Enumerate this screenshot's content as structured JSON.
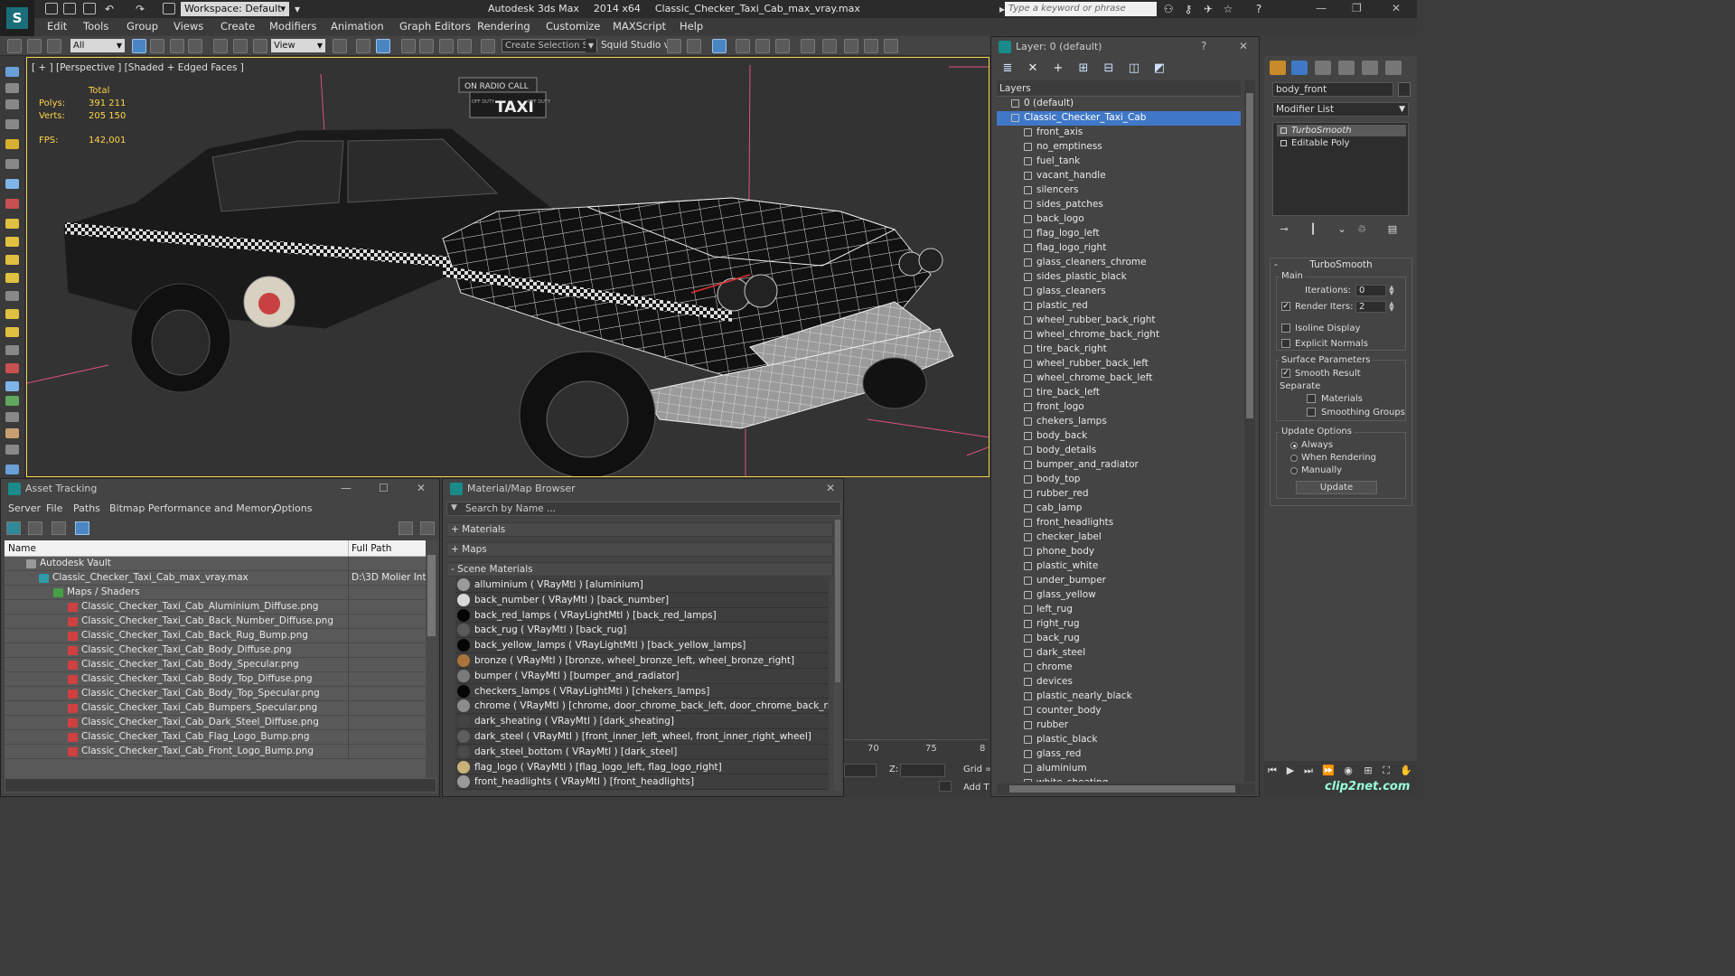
{
  "app": {
    "name": "Autodesk 3ds Max",
    "version": "2014 x64",
    "file": "Classic_Checker_Taxi_Cab_max_vray.max",
    "workspace": "Workspace: Default",
    "search_placeholder": "Type a keyword or phrase"
  },
  "menu": [
    "Edit",
    "Tools",
    "Group",
    "Views",
    "Create",
    "Modifiers",
    "Animation",
    "Graph Editors",
    "Rendering",
    "Customize",
    "MAXScript",
    "Help"
  ],
  "toolbar": {
    "filter": "All",
    "ref_coord": "View",
    "selection_set": "Create Selection Se",
    "plugin": "Squid Studio v"
  },
  "viewport": {
    "label": "[ + ] [Perspective ] [Shaded + Edged Faces ]",
    "stats_header": "Total",
    "polys_label": "Polys:",
    "polys_value": "391 211",
    "verts_label": "Verts:",
    "verts_value": "205 150",
    "fps_label": "FPS:",
    "fps_value": "142,001",
    "taxi_sign_top": "ON RADIO CALL",
    "taxi_sign_main": "TAXI",
    "taxi_sign_left": "OFF DUTY",
    "taxi_sign_right": "OFF DUTY"
  },
  "asset_tracking": {
    "title": "Asset Tracking",
    "menu": [
      "Server",
      "File",
      "Paths",
      "Bitmap Performance and Memory",
      "Options"
    ],
    "col_name": "Name",
    "col_path": "Full Path",
    "vault": "Autodesk Vault",
    "file": "Classic_Checker_Taxi_Cab_max_vray.max",
    "file_path": "D:\\3D Molier Int",
    "maps_group": "Maps / Shaders",
    "maps": [
      "Classic_Checker_Taxi_Cab_Aluminium_Diffuse.png",
      "Classic_Checker_Taxi_Cab_Back_Number_Diffuse.png",
      "Classic_Checker_Taxi_Cab_Back_Rug_Bump.png",
      "Classic_Checker_Taxi_Cab_Body_Diffuse.png",
      "Classic_Checker_Taxi_Cab_Body_Specular.png",
      "Classic_Checker_Taxi_Cab_Body_Top_Diffuse.png",
      "Classic_Checker_Taxi_Cab_Body_Top_Specular.png",
      "Classic_Checker_Taxi_Cab_Bumpers_Specular.png",
      "Classic_Checker_Taxi_Cab_Dark_Steel_Diffuse.png",
      "Classic_Checker_Taxi_Cab_Flag_Logo_Bump.png",
      "Classic_Checker_Taxi_Cab_Front_Logo_Bump.png"
    ]
  },
  "material_browser": {
    "title": "Material/Map Browser",
    "search_placeholder": "Search by Name ...",
    "sections": [
      "+ Materials",
      "+ Maps",
      "- Scene Materials"
    ],
    "materials": [
      {
        "text": "alluminium  ( VRayMtl )  [aluminium]",
        "color": "#9a9a9a"
      },
      {
        "text": "back_number  ( VRayMtl )  [back_number]",
        "color": "#d8d8d8"
      },
      {
        "text": "back_red_lamps  ( VRayLightMtl )  [back_red_lamps]",
        "color": "#050505"
      },
      {
        "text": "back_rug  ( VRayMtl )  [back_rug]",
        "color": "#5a5a5a"
      },
      {
        "text": "back_yellow_lamps  ( VRayLightMtl )  [back_yellow_lamps]",
        "color": "#050505"
      },
      {
        "text": "bronze  ( VRayMtl )  [bronze, wheel_bronze_left, wheel_bronze_right]",
        "color": "#a8743a"
      },
      {
        "text": "bumper  ( VRayMtl )  [bumper_and_radiator]",
        "color": "#7a7a7a"
      },
      {
        "text": "checkers_lamps  ( VRayLightMtl )  [chekers_lamps]",
        "color": "#050505"
      },
      {
        "text": "chrome  ( VRayMtl )  [chrome, door_chrome_back_left, door_chrome_back_right...",
        "color": "#8c8c8c"
      },
      {
        "text": "dark_sheating  ( VRayMtl )  [dark_sheating]",
        "color": "#444444"
      },
      {
        "text": "dark_steel  ( VRayMtl )  [front_inner_left_wheel, front_inner_right_wheel]",
        "color": "#5e5e5e"
      },
      {
        "text": "dark_steel_bottom  ( VRayMtl )  [dark_steel]",
        "color": "#4a4a4a"
      },
      {
        "text": "flag_logo  ( VRayMtl )  [flag_logo_left, flag_logo_right]",
        "color": "#c9b27a"
      },
      {
        "text": "front_headlights  ( VRayMtl )  [front_headlights]",
        "color": "#9a9a9a"
      }
    ]
  },
  "layer_explorer": {
    "title": "Layer: 0 (default)",
    "help": "?",
    "header": "Layers",
    "default_layer": "0 (default)",
    "selected_layer": "Classic_Checker_Taxi_Cab",
    "objects": [
      "front_axis",
      "no_emptiness",
      "fuel_tank",
      "vacant_handle",
      "silencers",
      "sides_patches",
      "back_logo",
      "flag_logo_left",
      "flag_logo_right",
      "glass_cleaners_chrome",
      "sides_plastic_black",
      "glass_cleaners",
      "plastic_red",
      "wheel_rubber_back_right",
      "wheel_chrome_back_right",
      "tire_back_right",
      "wheel_rubber_back_left",
      "wheel_chrome_back_left",
      "tire_back_left",
      "front_logo",
      "chekers_lamps",
      "body_back",
      "body_details",
      "bumper_and_radiator",
      "body_top",
      "rubber_red",
      "cab_lamp",
      "front_headlights",
      "checker_label",
      "phone_body",
      "plastic_white",
      "under_bumper",
      "glass_yellow",
      "left_rug",
      "right_rug",
      "back_rug",
      "dark_steel",
      "chrome",
      "devices",
      "plastic_nearly_black",
      "counter_body",
      "rubber",
      "plastic_black",
      "glass_red",
      "aluminium",
      "white_sheating"
    ]
  },
  "command_panel": {
    "object_name": "body_front",
    "modifier_list": "Modifier List",
    "stack": [
      "TurboSmooth",
      "Editable Poly"
    ],
    "rollout_title": "TurboSmooth",
    "group_main": "Main",
    "iterations_label": "Iterations:",
    "iterations_value": "0",
    "render_iters_label": "Render Iters:",
    "render_iters_value": "2",
    "isoline_display": "Isoline Display",
    "explicit_normals": "Explicit Normals",
    "surface_params": "Surface Parameters",
    "smooth_result": "Smooth Result",
    "separate": "Separate",
    "materials": "Materials",
    "smoothing_groups": "Smoothing Groups",
    "update_options": "Update Options",
    "always": "Always",
    "when_rendering": "When Rendering",
    "manually": "Manually",
    "update_button": "Update"
  },
  "timeline": {
    "ticks": [
      "70",
      "75",
      "8"
    ],
    "z_label": "Z:",
    "grid_label": "Grid =",
    "add_label": "Add T"
  },
  "watermark": "clip2net.com"
}
